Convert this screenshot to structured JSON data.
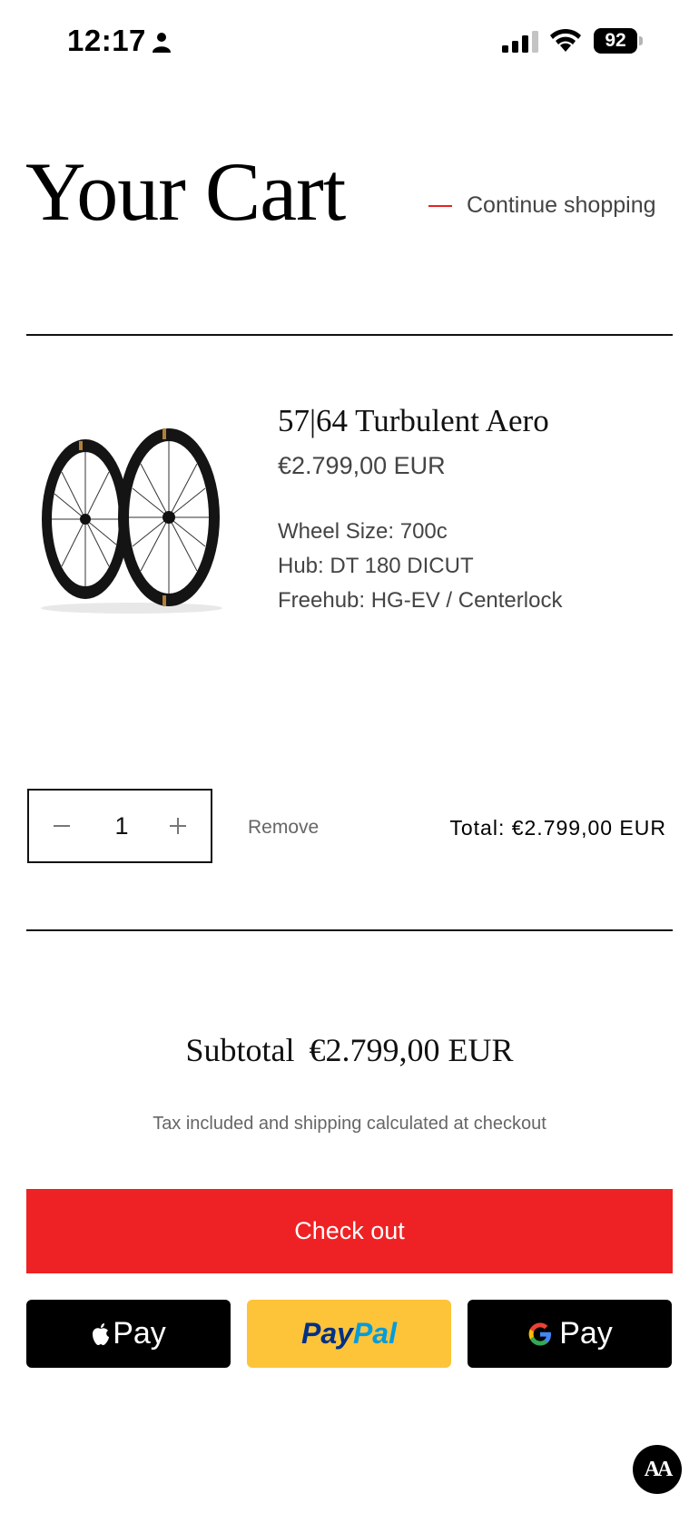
{
  "status_bar": {
    "time": "12:17",
    "battery": "92"
  },
  "header": {
    "title": "Your Cart",
    "continue_label": "Continue shopping"
  },
  "cart_item": {
    "name": "57|64 Turbulent Aero",
    "price": "€2.799,00 EUR",
    "variants": [
      "Wheel Size: 700c",
      "Hub: DT 180 DICUT",
      "Freehub: HG-EV / Centerlock"
    ],
    "quantity": "1",
    "remove_label": "Remove",
    "total_label": "Total: €2.799,00 EUR"
  },
  "summary": {
    "subtotal_label": "Subtotal",
    "subtotal_value": "€2.799,00 EUR",
    "tax_note": "Tax included and shipping calculated at checkout"
  },
  "actions": {
    "checkout_label": "Check out",
    "apple_pay_label": "Pay",
    "paypal_pay": "Pay",
    "paypal_pal": "Pal",
    "google_pay_label": "Pay",
    "accessibility_label": "AA"
  },
  "colors": {
    "accent_red": "#ee2224",
    "paypal_yellow": "#fdc439",
    "text_dark": "#111111",
    "text_muted": "#444444"
  },
  "icons": {
    "person": "person-icon",
    "signal": "signal-icon",
    "wifi": "wifi-icon",
    "battery": "battery-icon",
    "apple": "apple-icon",
    "google": "google-icon"
  }
}
